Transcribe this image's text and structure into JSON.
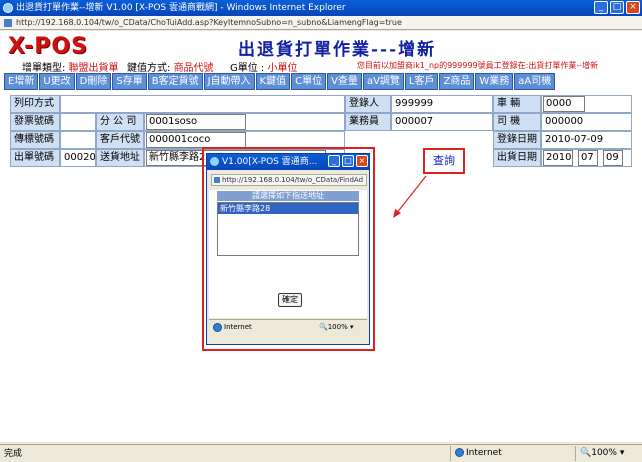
{
  "window": {
    "title": "出退貨打單作業--增新 V1.00 [X-POS 雲通商戰網] - Windows Internet Explorer",
    "address": "http://192.168.0.104/tw/o_CData/ChoTuiAdd.asp?KeyItemnoSubno=n_subno&LiamengFlag=true"
  },
  "header": {
    "logo": "X-POS",
    "page_title": "出退貨打單作業---增新",
    "type_label": "增單類型:",
    "type_value": "聯盟出貨單",
    "keymode_label": "鍵值方式:",
    "keymode_value": "商品代號",
    "unit_label": "G單位 :",
    "unit_value": "小單位",
    "notice": "您目前以加盟商ik1_np的999999號員工登錄在:出貨打單作業--增新"
  },
  "toolbar": [
    "E增新",
    "U更改",
    "D刪除",
    "S存單",
    "B客定貨號",
    "J自動帶入",
    "K鍵值",
    "C單位",
    "V查量",
    "aV調覽",
    "L客戶",
    "Z商品",
    "W業務",
    "aA司機"
  ],
  "form": {
    "print_label": "列印方式",
    "invoice_label": "發票號碼",
    "branch_label": "分 公 司",
    "branch_value": "0001soso",
    "fax_label": "傳標號碼",
    "customer_label": "客戶代號",
    "customer_value": "000001coco",
    "order_label": "出單號碼",
    "order_value": "000208",
    "delivery_label": "送貨地址",
    "delivery_value": "新竹縣李路28",
    "registrant_label": "登錄人",
    "registrant_value": "999999",
    "salesman_label": "業務員",
    "salesman_value": "000007",
    "vehicle_label": "車 輛",
    "vehicle_value": "0000",
    "driver_label": "司 機",
    "driver_value": "000000",
    "reg_date_label": "登錄日期",
    "reg_date_value": "2010-07-09",
    "ship_date_label": "出貨日期",
    "ship_year": "2010",
    "ship_month": "07",
    "ship_day": "09",
    "query_label": "查詢"
  },
  "popup": {
    "title": "V1.00[X-POS 雲通商...",
    "address": "http://192.168.0.104/tw/o_CData/FindAd",
    "heading": "請選擇如下指送地址",
    "items": [
      "新竹縣李路28"
    ],
    "ok_label": "確定",
    "zone": "Internet",
    "zoom": "100%"
  },
  "status": {
    "left": "完成",
    "zone": "Internet",
    "zoom": "100%"
  },
  "colors": {
    "accent": "#5d8fd6",
    "label_bg": "#cfe0f4",
    "highlight": "#e02020",
    "title_blue": "#1020a0"
  }
}
